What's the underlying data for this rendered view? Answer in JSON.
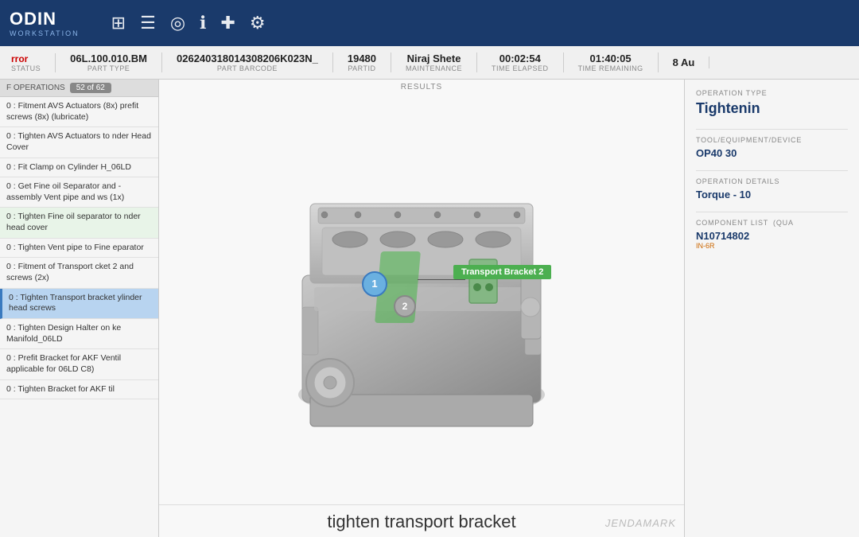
{
  "header": {
    "logo": "ODIN",
    "logo_sub": "WORKSTATION",
    "icons": [
      {
        "name": "grid-settings-icon",
        "symbol": "⊞"
      },
      {
        "name": "list-icon",
        "symbol": "☰"
      },
      {
        "name": "target-icon",
        "symbol": "◎"
      },
      {
        "name": "info-icon",
        "symbol": "ℹ"
      },
      {
        "name": "add-icon",
        "symbol": "+"
      },
      {
        "name": "settings-icon",
        "symbol": "⚙"
      }
    ]
  },
  "status_bar": {
    "error_label": "rror",
    "error_status": "STATUS",
    "part_type_value": "06L.100.010.BM",
    "part_type_label": "PART TYPE",
    "part_barcode_value": "026240318014308206K023N_",
    "part_barcode_label": "PART BARCODE",
    "partid_value": "19480",
    "partid_label": "PARTID",
    "maintenance_value": "Niraj Shete",
    "maintenance_label": "MAINTENANCE",
    "time_elapsed_value": "00:02:54",
    "time_elapsed_label": "TIME ELAPSED",
    "time_remaining_value": "01:40:05",
    "time_remaining_label": "TIME REMAINING",
    "date_value": "8 Au"
  },
  "sidebar": {
    "header_label": "F OPERATIONS",
    "op_count": "52 of 62",
    "items": [
      {
        "id": 1,
        "text": "0 : Fitment AVS Actuators (8x) prefit screws (8x) (lubricate)"
      },
      {
        "id": 2,
        "text": "0 : Tighten AVS Actuators to nder Head Cover"
      },
      {
        "id": 3,
        "text": "0 : Fit Clamp on Cylinder H_06LD"
      },
      {
        "id": 4,
        "text": "0 : Get Fine oil Separator and -assembly Vent pipe and ws (1x)"
      },
      {
        "id": 5,
        "text": "0 : Tighten Fine oil separator to nder head cover",
        "highlighted": true
      },
      {
        "id": 6,
        "text": "0 : Tighten Vent pipe to Fine eparator"
      },
      {
        "id": 7,
        "text": "0 : Fitment of Transport cket 2 and screws (2x)"
      },
      {
        "id": 8,
        "text": "0 : Tighten Transport bracket ylinder head screws",
        "active": true
      },
      {
        "id": 9,
        "text": "0 : Tighten Design Halter on ke Manifold_06LD"
      },
      {
        "id": 10,
        "text": "0 : Prefit Bracket for AKF Ventil applicable for 06LD C8)"
      },
      {
        "id": 11,
        "text": "0 : Tighten Bracket for AKF til"
      }
    ]
  },
  "center": {
    "results_label": "RESULTS",
    "caption": "tighten transport bracket",
    "callout1": "1",
    "callout2": "2",
    "bracket_label": "Transport Bracket 2",
    "watermark": "JENDAMARK"
  },
  "right_panel": {
    "operation_type_label": "OPERATION TYPE",
    "operation_type_value": "Tightenin",
    "tool_label": "TOOL/EQUIPMENT/DEVICE",
    "tool_value": "OP40 30",
    "operation_details_label": "OPERATION DETAILS",
    "torque_value": "Torque - 10",
    "component_list_label": "COMPONENT LIST",
    "quantity_label": "(QUA",
    "component_value": "N10714802",
    "component_sub": "IN-6R"
  }
}
